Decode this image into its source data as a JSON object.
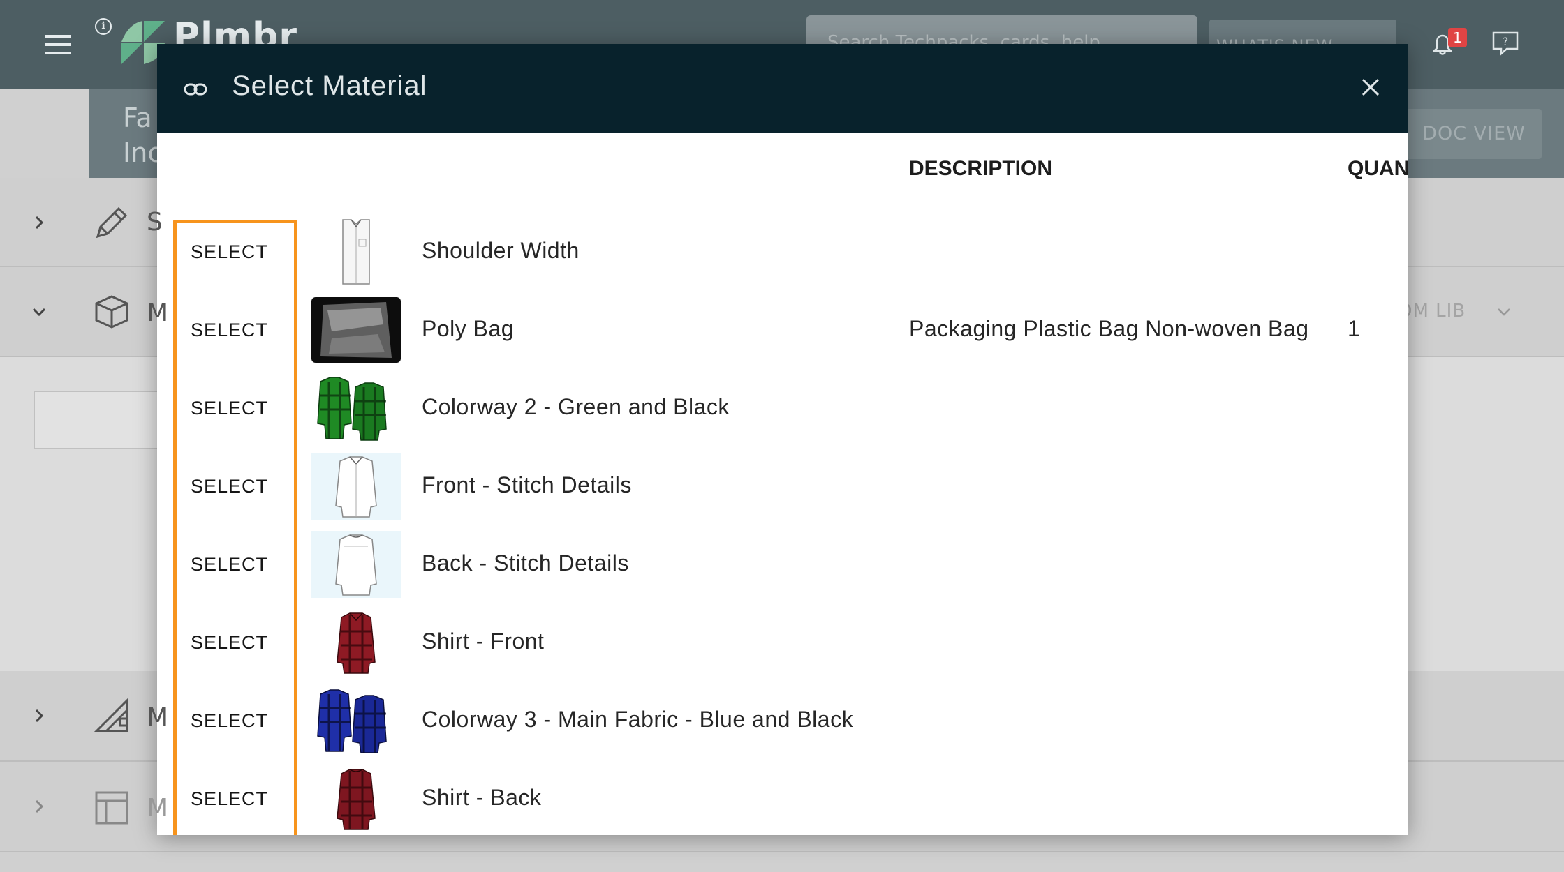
{
  "app": {
    "brand": "Plmbr",
    "search_placeholder": "Search Techpacks, cards, help",
    "whats_new": "WHAT'S NEW",
    "notification_count": "1",
    "subheader_line1": "Fa",
    "subheader_line2": "Inc",
    "doc_view": "DOC VIEW",
    "bom_lib": "OM LIB",
    "row_letters": [
      "S",
      "M",
      "M",
      "M"
    ]
  },
  "modal": {
    "title": "Select Material",
    "columns": {
      "description": "DESCRIPTION",
      "quantity": "QUAN"
    },
    "highlight_color": "#f7941d",
    "header_color": "#08222c",
    "rows": [
      {
        "select": "SELECT",
        "name": "Shoulder Width",
        "description": "",
        "quantity": "",
        "thumb": "white-vest-icon"
      },
      {
        "select": "SELECT",
        "name": "Poly Bag",
        "description": "Packaging Plastic Bag Non-woven Bag",
        "quantity": "1",
        "thumb": "poly-bag-icon"
      },
      {
        "select": "SELECT",
        "name": "Colorway 2 - Green and Black",
        "description": "",
        "quantity": "",
        "thumb": "green-plaid-shirts-icon"
      },
      {
        "select": "SELECT",
        "name": "Front - Stitch Details",
        "description": "",
        "quantity": "",
        "thumb": "white-shirt-front-icon"
      },
      {
        "select": "SELECT",
        "name": "Back - Stitch Details",
        "description": "",
        "quantity": "",
        "thumb": "white-shirt-back-icon"
      },
      {
        "select": "SELECT",
        "name": "Shirt - Front",
        "description": "",
        "quantity": "",
        "thumb": "red-plaid-shirt-front-icon"
      },
      {
        "select": "SELECT",
        "name": "Colorway 3 - Main Fabric - Blue and Black",
        "description": "",
        "quantity": "",
        "thumb": "blue-plaid-shirts-icon"
      },
      {
        "select": "SELECT",
        "name": "Shirt - Back",
        "description": "",
        "quantity": "",
        "thumb": "red-plaid-shirt-back-icon"
      }
    ]
  }
}
